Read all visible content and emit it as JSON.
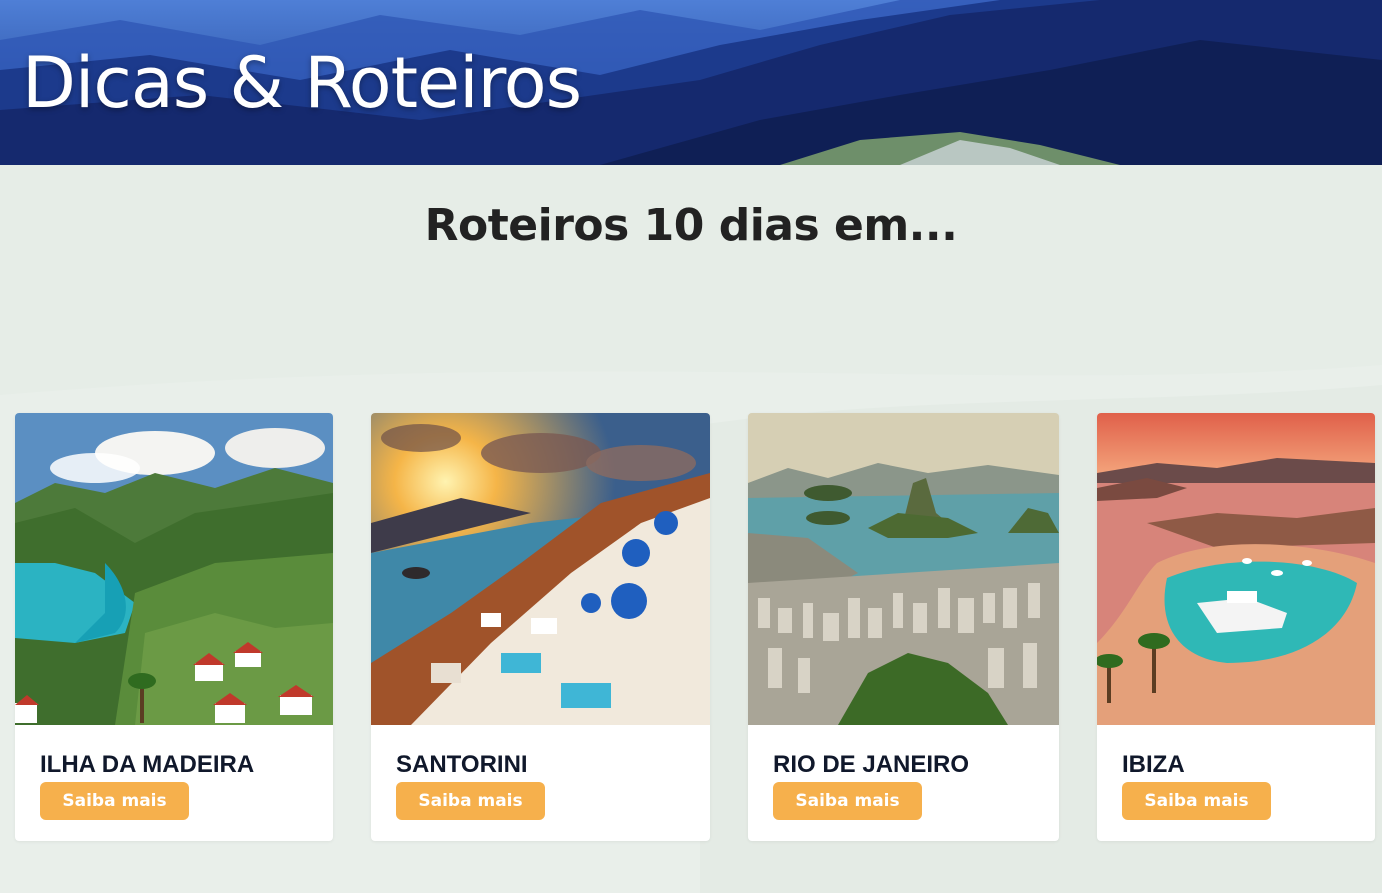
{
  "hero": {
    "title": "Dicas & Roteiros"
  },
  "section": {
    "title": "Roteiros 10 dias em..."
  },
  "cards": [
    {
      "name": "ILHA DA MADEIRA",
      "button": "Saiba mais",
      "image": "madeira-island-landscape"
    },
    {
      "name": "SANTORINI",
      "button": "Saiba mais",
      "image": "santorini-sunset-village"
    },
    {
      "name": "RIO DE JANEIRO",
      "button": "Saiba mais",
      "image": "rio-de-janeiro-bay"
    },
    {
      "name": "IBIZA",
      "button": "Saiba mais",
      "image": "ibiza-bay-yacht"
    }
  ],
  "colors": {
    "accent": "#f6b04c",
    "background": "#e9efea",
    "hero": "#12276b",
    "card_title": "#10182b"
  }
}
